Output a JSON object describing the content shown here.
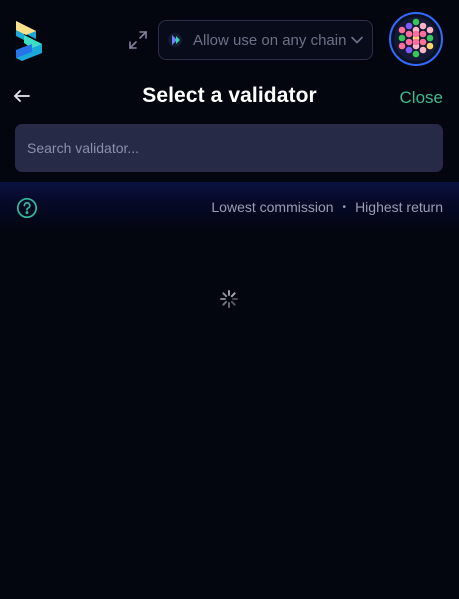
{
  "header": {
    "logo_icon": "app-logo-icon",
    "expand_icon": "expand-arrows-icon",
    "chain_selector": {
      "icon": "chain-token-icon",
      "label": "Allow use on any chain",
      "chevron_icon": "chevron-down-icon"
    },
    "account_avatar": "identicon-avatar"
  },
  "title_row": {
    "back_icon": "arrow-left-icon",
    "title": "Select a validator",
    "close_label": "Close"
  },
  "search": {
    "placeholder": "Search validator...",
    "value": ""
  },
  "sort": {
    "help_icon": "question-circle-icon",
    "options": [
      "Lowest commission",
      "Highest return"
    ],
    "separator": "•"
  },
  "content": {
    "state": "loading",
    "spinner_icon": "loading-spinner-icon"
  },
  "colors": {
    "background": "#03050f",
    "accent_green": "#3fba8c",
    "search_bg": "#262a47",
    "avatar_ring": "#2f6bff",
    "muted_text": "#9a9db3"
  }
}
